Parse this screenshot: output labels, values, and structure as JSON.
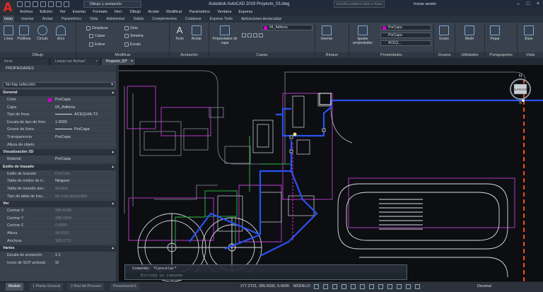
{
  "titlebar": {
    "workspace": "Dibujo y anotación",
    "title": "Autodesk AutoCAD 2019    Proyecto_03.dwg",
    "search_placeholder": "Escriba palabra clave o frase",
    "signin": "Iniciar sesión"
  },
  "menu": [
    "Archivo",
    "Edición",
    "Ver",
    "Insertar",
    "Formato",
    "Herr.",
    "Dibujo",
    "Acotar",
    "Modificar",
    "Parametrico",
    "Ventana",
    "Express"
  ],
  "ribbon_tabs": [
    "Inicio",
    "Insertar",
    "Anotar",
    "Paramétrico",
    "Vista",
    "Administrar",
    "Salida",
    "Complementos",
    "Colaborar",
    "Express Tools",
    "Aplicaciones destacadas"
  ],
  "ribbon": {
    "draw": {
      "title": "Dibujo",
      "tools": [
        "Línea",
        "Polilínea",
        "Círculo",
        "Arco"
      ]
    },
    "modify": {
      "title": "Modificar",
      "tools": [
        "Desplazar",
        "Girar",
        "Copiar",
        "Simetría",
        "Estirar",
        "Escala"
      ]
    },
    "annotation": {
      "title": "Anotación",
      "tools": [
        "Texto",
        "Acotar"
      ]
    },
    "layers": {
      "title": "Capas",
      "tool": "Propiedades de capa",
      "current": "04_Aditivos"
    },
    "block": {
      "title": "Bloque",
      "tool": "Insertar"
    },
    "properties": {
      "title": "Propiedades",
      "tool": "Igualar propiedades",
      "color": "PorCapa",
      "linetype": "PorCapa",
      "lineweight": "ACEQ..."
    },
    "groups": {
      "title": "Grupos",
      "tool": "Grupo"
    },
    "utilities": {
      "title": "Utilidades",
      "tool": "Medir"
    },
    "clipboard": {
      "title": "Portapapeles",
      "tool": "Pegar"
    },
    "view": {
      "title": "Vista",
      "tool": "Base"
    }
  },
  "doc_tabs": [
    "Inicio",
    "Lineas con flechas*",
    "Proyecto_03*"
  ],
  "properties": {
    "title": "PROPIEDADES",
    "selection": "No hay selección",
    "general": {
      "title": "General",
      "rows": [
        {
          "k": "Color",
          "v": "PorCapa"
        },
        {
          "k": "Capa",
          "v": "04_Aditivos"
        },
        {
          "k": "Tipo de línea",
          "v": "ACEQUIA-T3"
        },
        {
          "k": "Escala de tipo de línea",
          "v": "1.0000"
        },
        {
          "k": "Grosor de línea",
          "v": "PorCapa"
        },
        {
          "k": "Transparencia",
          "v": "PorCapa"
        },
        {
          "k": "Altura de objeto",
          "v": ""
        }
      ]
    },
    "viz3d": {
      "title": "Visualización 3D",
      "rows": [
        {
          "k": "Material",
          "v": "PorCapa"
        }
      ]
    },
    "plot": {
      "title": "Estilo de trazado",
      "rows": [
        {
          "k": "Estilo de trazado",
          "v": "PorColor"
        },
        {
          "k": "Tabla de estilos de tr...",
          "v": "Ninguno"
        },
        {
          "k": "Tabla de trazado aso...",
          "v": "Modelo"
        },
        {
          "k": "Tipo de tabla de traz...",
          "v": "No está disponible"
        }
      ]
    },
    "view": {
      "title": "Ver",
      "rows": [
        {
          "k": "Centrar X",
          "v": "280.4188"
        },
        {
          "k": "Centrar Y",
          "v": "288.2824"
        },
        {
          "k": "Centrar Z",
          "v": "0.0000"
        },
        {
          "k": "Altura",
          "v": "94.6932"
        },
        {
          "k": "Anchura",
          "v": "188.0711"
        }
      ]
    },
    "misc": {
      "title": "Varios",
      "rows": [
        {
          "k": "Escala de anotación",
          "v": "1:1"
        },
        {
          "k": "Icono de SCP activado",
          "v": "Sí"
        }
      ]
    }
  },
  "command": {
    "history": "Comando: *Cancelar*",
    "placeholder": "Escriba un comando"
  },
  "viewcube": {
    "north": "N",
    "south": "S",
    "face": "SUPERIOR"
  },
  "status": {
    "layout_tabs": [
      "Modelo",
      "1-Planta General",
      "2-Red del Proceso",
      "Presentación1"
    ],
    "coords": "277.2721, 305.5032, 0.0000",
    "space": "MODELO",
    "units": "Decimal"
  }
}
